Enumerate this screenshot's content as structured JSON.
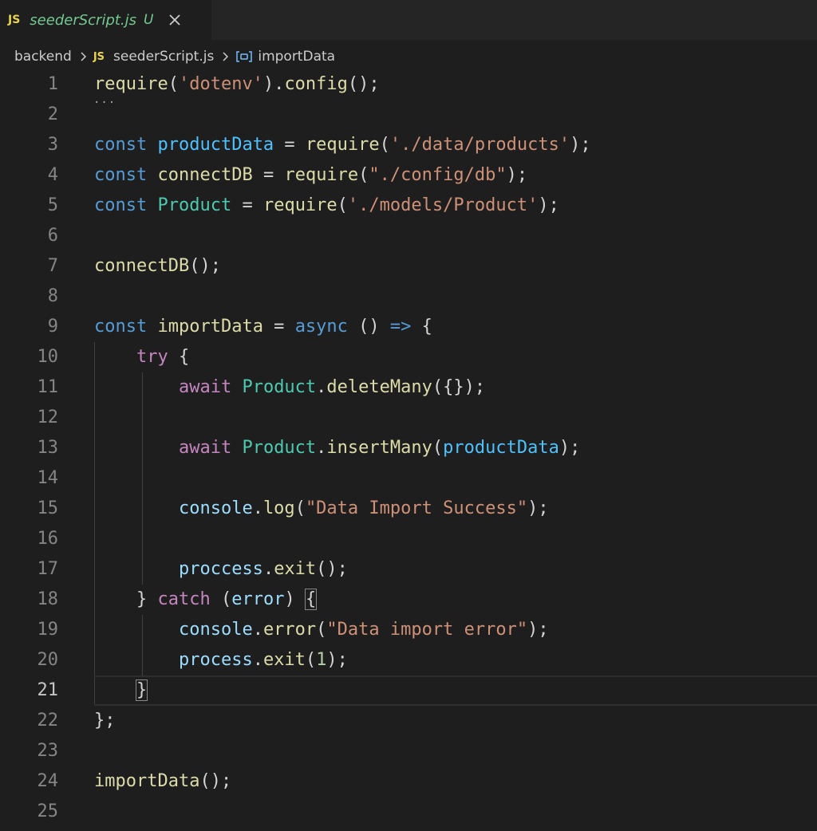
{
  "tab": {
    "lang_badge": "JS",
    "filename": "seederScript.js",
    "status": "U",
    "close_icon": "close-icon"
  },
  "breadcrumb": {
    "folder": "backend",
    "file_badge": "JS",
    "file": "seederScript.js",
    "symbol_icon": "variable-symbol-icon",
    "symbol": "importData"
  },
  "editor": {
    "active_line": 21,
    "lines": [
      {
        "n": "1",
        "tokens": [
          [
            "require",
            "fn"
          ],
          [
            "(",
            "pun"
          ],
          [
            "'dotenv'",
            "str"
          ],
          [
            ").",
            "pun"
          ],
          [
            "config",
            "fn"
          ],
          [
            "();",
            "pun"
          ]
        ]
      },
      {
        "n": "2",
        "tokens": []
      },
      {
        "n": "3",
        "tokens": [
          [
            "const",
            "kw"
          ],
          [
            " ",
            "pun"
          ],
          [
            "productData",
            "var"
          ],
          [
            " = ",
            "pun"
          ],
          [
            "require",
            "fn"
          ],
          [
            "(",
            "pun"
          ],
          [
            "'./data/products'",
            "str"
          ],
          [
            ");",
            "pun"
          ]
        ]
      },
      {
        "n": "4",
        "tokens": [
          [
            "const",
            "kw"
          ],
          [
            " ",
            "pun"
          ],
          [
            "connectDB",
            "fn"
          ],
          [
            " = ",
            "pun"
          ],
          [
            "require",
            "fn"
          ],
          [
            "(",
            "pun"
          ],
          [
            "\"./config/db\"",
            "str"
          ],
          [
            ");",
            "pun"
          ]
        ]
      },
      {
        "n": "5",
        "tokens": [
          [
            "const",
            "kw"
          ],
          [
            " ",
            "pun"
          ],
          [
            "Product",
            "cls"
          ],
          [
            " = ",
            "pun"
          ],
          [
            "require",
            "fn"
          ],
          [
            "(",
            "pun"
          ],
          [
            "'./models/Product'",
            "str"
          ],
          [
            ");",
            "pun"
          ]
        ]
      },
      {
        "n": "6",
        "tokens": []
      },
      {
        "n": "7",
        "tokens": [
          [
            "connectDB",
            "fn"
          ],
          [
            "();",
            "pun"
          ]
        ]
      },
      {
        "n": "8",
        "tokens": []
      },
      {
        "n": "9",
        "tokens": [
          [
            "const",
            "kw"
          ],
          [
            " ",
            "pun"
          ],
          [
            "importData",
            "fn"
          ],
          [
            " = ",
            "pun"
          ],
          [
            "async",
            "kw"
          ],
          [
            " () ",
            "pun"
          ],
          [
            "=>",
            "kw"
          ],
          [
            " {",
            "pun"
          ]
        ]
      },
      {
        "n": "10",
        "tokens": [
          [
            "    ",
            "pun"
          ],
          [
            "try",
            "ctrl"
          ],
          [
            " {",
            "pun"
          ]
        ]
      },
      {
        "n": "11",
        "tokens": [
          [
            "        ",
            "pun"
          ],
          [
            "await",
            "ctrl"
          ],
          [
            " ",
            "pun"
          ],
          [
            "Product",
            "cls"
          ],
          [
            ".",
            "pun"
          ],
          [
            "deleteMany",
            "fn"
          ],
          [
            "({});",
            "pun"
          ]
        ]
      },
      {
        "n": "12",
        "tokens": []
      },
      {
        "n": "13",
        "tokens": [
          [
            "        ",
            "pun"
          ],
          [
            "await",
            "ctrl"
          ],
          [
            " ",
            "pun"
          ],
          [
            "Product",
            "cls"
          ],
          [
            ".",
            "pun"
          ],
          [
            "insertMany",
            "fn"
          ],
          [
            "(",
            "pun"
          ],
          [
            "productData",
            "var"
          ],
          [
            ");",
            "pun"
          ]
        ]
      },
      {
        "n": "14",
        "tokens": []
      },
      {
        "n": "15",
        "tokens": [
          [
            "        ",
            "pun"
          ],
          [
            "console",
            "prm"
          ],
          [
            ".",
            "pun"
          ],
          [
            "log",
            "fn"
          ],
          [
            "(",
            "pun"
          ],
          [
            "\"Data Import Success\"",
            "str"
          ],
          [
            ");",
            "pun"
          ]
        ]
      },
      {
        "n": "16",
        "tokens": []
      },
      {
        "n": "17",
        "tokens": [
          [
            "        ",
            "pun"
          ],
          [
            "proccess",
            "prm"
          ],
          [
            ".",
            "pun"
          ],
          [
            "exit",
            "fn"
          ],
          [
            "();",
            "pun"
          ]
        ]
      },
      {
        "n": "18",
        "tokens": [
          [
            "    } ",
            "pun"
          ],
          [
            "catch",
            "ctrl"
          ],
          [
            " (",
            "pun"
          ],
          [
            "error",
            "prm"
          ],
          [
            ") ",
            "pun"
          ],
          [
            "{",
            "box"
          ]
        ]
      },
      {
        "n": "19",
        "tokens": [
          [
            "        ",
            "pun"
          ],
          [
            "console",
            "prm"
          ],
          [
            ".",
            "pun"
          ],
          [
            "error",
            "fn"
          ],
          [
            "(",
            "pun"
          ],
          [
            "\"Data import error\"",
            "str"
          ],
          [
            ");",
            "pun"
          ]
        ]
      },
      {
        "n": "20",
        "tokens": [
          [
            "        ",
            "pun"
          ],
          [
            "process",
            "prm"
          ],
          [
            ".",
            "pun"
          ],
          [
            "exit",
            "fn"
          ],
          [
            "(",
            "pun"
          ],
          [
            "1",
            "num"
          ],
          [
            ");",
            "pun"
          ]
        ]
      },
      {
        "n": "21",
        "tokens": [
          [
            "    ",
            "pun"
          ],
          [
            "}",
            "box"
          ]
        ]
      },
      {
        "n": "22",
        "tokens": [
          [
            "};",
            "pun"
          ]
        ]
      },
      {
        "n": "23",
        "tokens": []
      },
      {
        "n": "24",
        "tokens": [
          [
            "importData",
            "fn"
          ],
          [
            "();",
            "pun"
          ]
        ]
      },
      {
        "n": "25",
        "tokens": []
      }
    ]
  },
  "colors": {
    "background": "#1e1e1e",
    "tabbar": "#252526",
    "function": "#dcdcaa",
    "string": "#ce9178",
    "keyword": "#569cd6",
    "variable": "#4fc1ff",
    "class": "#4ec9b0",
    "control": "#c586c0",
    "property": "#9cdcfe",
    "number": "#b5cea8",
    "js_badge": "#e8d44d",
    "untracked": "#73c991"
  }
}
